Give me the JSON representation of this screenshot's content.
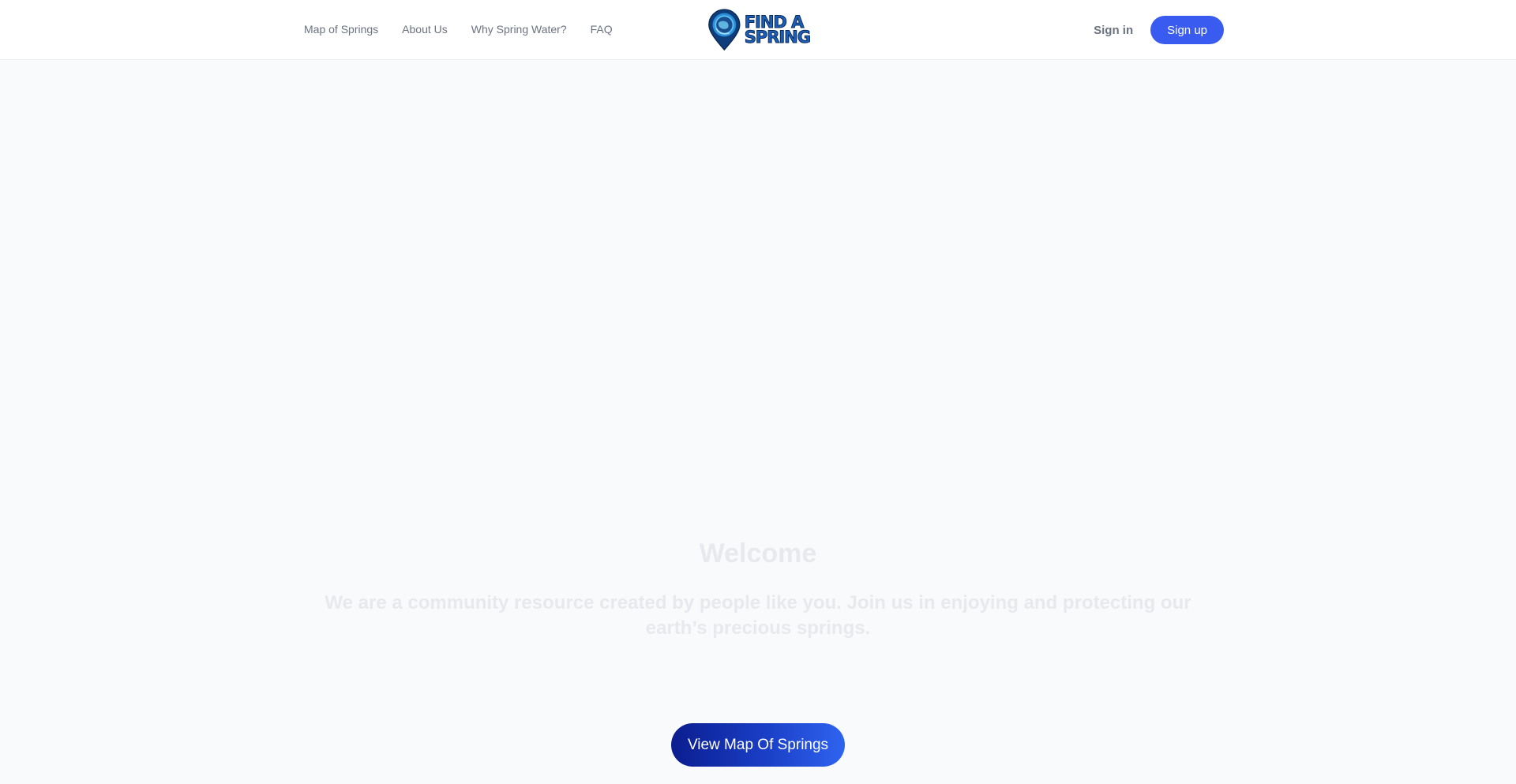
{
  "nav": {
    "items": [
      {
        "label": "Map of Springs"
      },
      {
        "label": "About Us"
      },
      {
        "label": "Why Spring Water?"
      },
      {
        "label": "FAQ"
      }
    ]
  },
  "logo": {
    "line1": "FIND A",
    "line2": "SPRING",
    "icon": "map-pin-globe-icon"
  },
  "auth": {
    "signin_label": "Sign in",
    "signup_label": "Sign up"
  },
  "hero": {
    "title": "Welcome",
    "tagline": "We are a community resource created by people like you. Join us in enjoying and protecting our earth’s precious springs.",
    "cta_label": "View Map Of Springs"
  },
  "colors": {
    "accent": "#3a5bf0",
    "cta_start": "#0b1d8f",
    "cta_end": "#2f64f0",
    "nav_text": "#6b7280",
    "faded_text": "#e7e9ed"
  }
}
